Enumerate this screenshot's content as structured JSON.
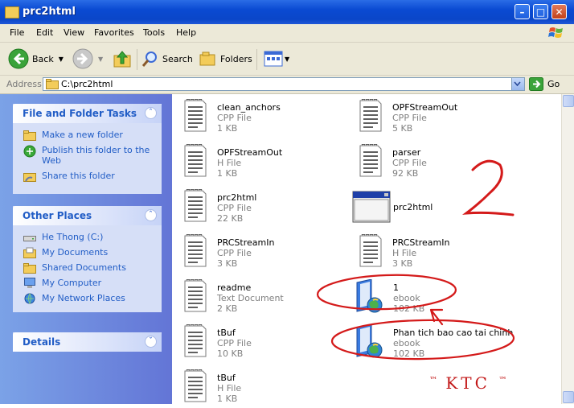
{
  "window": {
    "title": "prc2html"
  },
  "menu": [
    "File",
    "Edit",
    "View",
    "Favorites",
    "Tools",
    "Help"
  ],
  "toolbar": {
    "back": "Back",
    "search": "Search",
    "folders": "Folders"
  },
  "address": {
    "label": "Address",
    "value": "C:\\prc2html",
    "go": "Go"
  },
  "tasks": {
    "title": "File and Folder Tasks",
    "items": [
      "Make a new folder",
      "Publish this folder to the Web",
      "Share this folder"
    ]
  },
  "places": {
    "title": "Other Places",
    "items": [
      "He Thong (C:)",
      "My Documents",
      "Shared Documents",
      "My Computer",
      "My Network Places"
    ]
  },
  "details": {
    "title": "Details"
  },
  "files": [
    {
      "name": "clean_anchors",
      "type": "CPP File",
      "size": "1 KB",
      "icon": "cpp-file-icon"
    },
    {
      "name": "OPFStreamOut",
      "type": "CPP File",
      "size": "5 KB",
      "icon": "cpp-file-icon"
    },
    {
      "name": "OPFStreamOut",
      "type": "H File",
      "size": "1 KB",
      "icon": "h-file-icon"
    },
    {
      "name": "parser",
      "type": "CPP File",
      "size": "92 KB",
      "icon": "cpp-file-icon"
    },
    {
      "name": "prc2html",
      "type": "CPP File",
      "size": "22 KB",
      "icon": "cpp-file-icon"
    },
    {
      "name": "prc2html",
      "type": "",
      "size": "",
      "icon": "application-icon"
    },
    {
      "name": "PRCStreamIn",
      "type": "CPP File",
      "size": "3 KB",
      "icon": "cpp-file-icon"
    },
    {
      "name": "PRCStreamIn",
      "type": "H File",
      "size": "3 KB",
      "icon": "h-file-icon"
    },
    {
      "name": "readme",
      "type": "Text Document",
      "size": "2 KB",
      "icon": "text-document-icon"
    },
    {
      "name": "1",
      "type": "ebook",
      "size": "102 KB",
      "icon": "ebook-icon"
    },
    {
      "name": "tBuf",
      "type": "CPP File",
      "size": "10 KB",
      "icon": "cpp-file-icon"
    },
    {
      "name": "Phan tich bao cao tai chinh",
      "type": "ebook",
      "size": "102 KB",
      "icon": "ebook-icon"
    },
    {
      "name": "tBuf",
      "type": "H File",
      "size": "1 KB",
      "icon": "h-file-icon"
    }
  ],
  "annotation": {
    "number": "2",
    "watermark": "KTC",
    "tm": "™",
    "color": "#d41a1a"
  }
}
